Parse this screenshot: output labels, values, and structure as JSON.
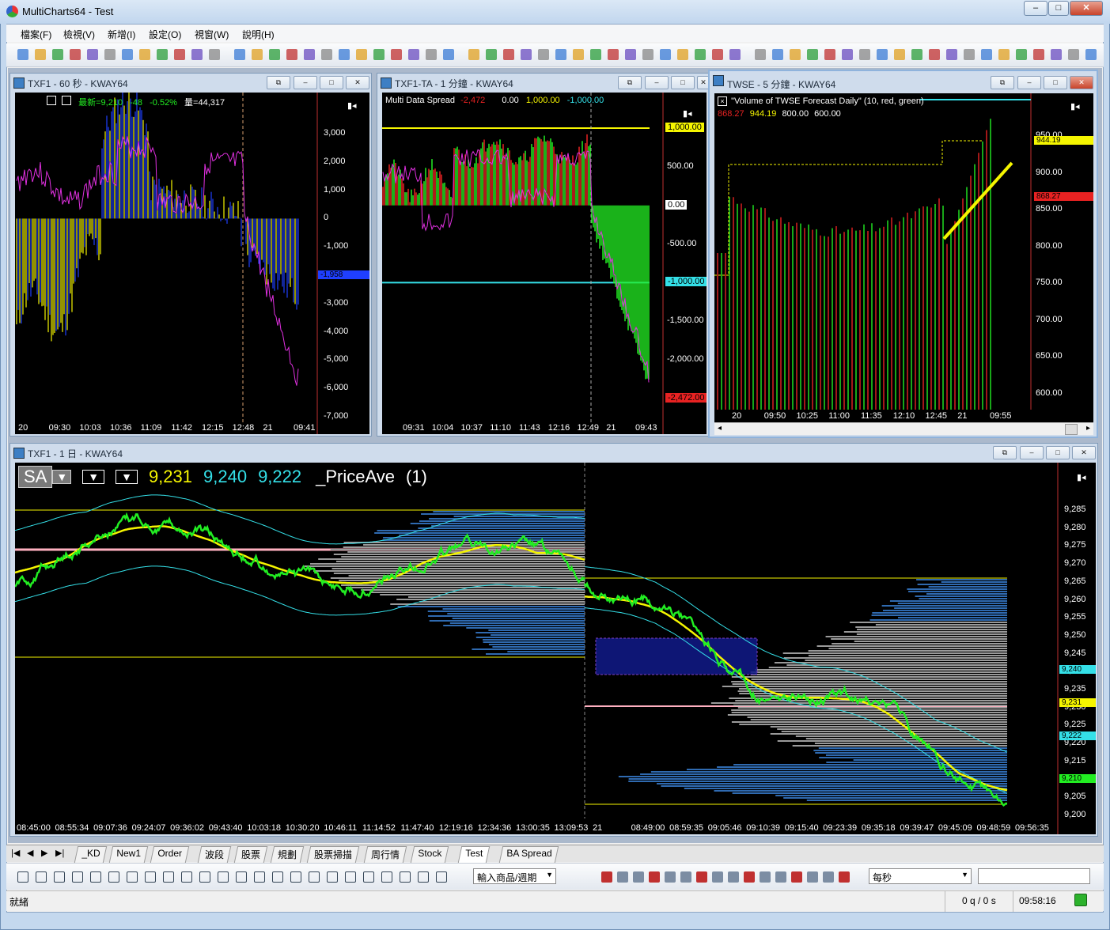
{
  "app": {
    "title": "MultiCharts64 - Test",
    "window_buttons": [
      "–",
      "□",
      "✕"
    ]
  },
  "menu": [
    "檔案(F)",
    "檢視(V)",
    "新增(I)",
    "設定(O)",
    "視窗(W)",
    "說明(H)"
  ],
  "windows": {
    "w1": {
      "title": "TXF1 - 60 秒 - KWAY64",
      "legend_last": "最新=9,210",
      "legend_chg": "-48",
      "legend_pct": "-0.52%",
      "legend_vol": "量=44,317",
      "y_ticks": [
        "3,000",
        "2,000",
        "1,000",
        "0",
        "-1,000",
        "-2,000",
        "-3,000",
        "-4,000",
        "-5,000",
        "-6,000",
        "-7,000"
      ],
      "marker": "-1,958",
      "x_ticks": [
        "20",
        "09:30",
        "10:03",
        "10:36",
        "11:09",
        "11:42",
        "12:15",
        "12:48",
        "21",
        "09:41"
      ]
    },
    "w2": {
      "title": "TXF1-TA - 1 分鐘 - KWAY64",
      "study": "Multi Data Spread",
      "study_value": "-2,472",
      "study_p1": "0.00",
      "study_p2": "1,000.00",
      "study_p3": "-1,000.00",
      "y_ticks": [
        "1,000.00",
        "500.00",
        "0.00",
        "-500.00",
        "-1,000.00",
        "-1,500.00",
        "-2,000.00",
        "-2,472.00"
      ],
      "x_ticks": [
        "09:31",
        "10:04",
        "10:37",
        "11:10",
        "11:43",
        "12:16",
        "12:49",
        "21",
        "09:43"
      ]
    },
    "w3": {
      "title": "TWSE - 5 分鐘 - KWAY64",
      "study": "\"Volume of TWSE Forecast Daily\" (10,  red,  green)",
      "v1": "868.27",
      "v2": "944.19",
      "v3": "800.00",
      "v4": "600.00",
      "y_ticks": [
        "950.00",
        "900.00",
        "850.00",
        "800.00",
        "750.00",
        "700.00",
        "650.00",
        "600.00"
      ],
      "marker_yellow": "944.19",
      "marker_red": "868.27",
      "x_ticks": [
        "20",
        "09:50",
        "10:25",
        "11:00",
        "11:35",
        "12:10",
        "12:45",
        "21",
        "09:55"
      ]
    },
    "w4": {
      "title": "TXF1 - 1 日 - KWAY64",
      "symbol": "SA",
      "val1": "9,231",
      "val2": "9,240",
      "val3": "9,222",
      "study": "_PriceAve",
      "study_param": "(1)",
      "y_ticks": [
        "9,285",
        "9,280",
        "9,275",
        "9,270",
        "9,265",
        "9,260",
        "9,255",
        "9,250",
        "9,245",
        "9,240",
        "9,235",
        "9,230",
        "9,225",
        "9,220",
        "9,215",
        "9,210",
        "9,205",
        "9,200"
      ],
      "markers": {
        "cyan1": "9,240",
        "yellow": "9,231",
        "cyan2": "9,222",
        "green": "9,210"
      },
      "x_ticks": [
        "08:45:00",
        "08:55:34",
        "09:07:36",
        "09:24:07",
        "09:36:02",
        "09:43:40",
        "10:03:18",
        "10:30:20",
        "10:46:11",
        "11:14:52",
        "11:47:40",
        "12:19:16",
        "12:34:36",
        "13:00:35",
        "13:09:53",
        "21",
        "08:49:00",
        "08:59:35",
        "09:05:46",
        "09:10:39",
        "09:15:40",
        "09:23:39",
        "09:35:18",
        "09:39:47",
        "09:45:09",
        "09:48:59",
        "09:56:35"
      ]
    }
  },
  "tabs": [
    "_KD",
    "New1",
    "Order",
    "波段",
    "股票",
    "規劃",
    "股票掃描",
    "周行情",
    "Stock",
    "Test",
    "BA Spread"
  ],
  "active_tab": "Test",
  "drawbar": {
    "symbol_select": "輸入商品/週期",
    "interval_select": "每秒"
  },
  "status": {
    "ready": "就緒",
    "queue": "0 q / 0 s",
    "time": "09:58:16"
  },
  "colors": {
    "green": "#22ee22",
    "yellow": "#f5f500",
    "cyan": "#34e0e8",
    "magenta": "#e030e0",
    "blue": "#1f3fff",
    "red": "#e82222"
  }
}
